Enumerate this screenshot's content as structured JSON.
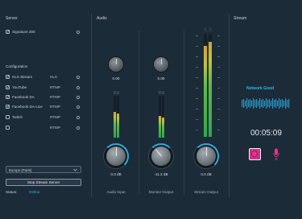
{
  "sections": {
    "server": "Server",
    "audio": "Audio",
    "stream": "Stream"
  },
  "server": {
    "name": "Signature 200",
    "checked": true
  },
  "configuration": {
    "title": "Configuration",
    "destinations": [
      {
        "name": "HLS Stream",
        "protocol": "HLS",
        "checked": true
      },
      {
        "name": "YouTube",
        "protocol": "RTMP",
        "checked": true
      },
      {
        "name": "Facebook DA",
        "protocol": "RTMP",
        "checked": true
      },
      {
        "name": "Facebook DA-Live",
        "protocol": "RTMP",
        "checked": true
      },
      {
        "name": "Twitch",
        "protocol": "RTMP",
        "checked": false
      },
      {
        "name": "",
        "protocol": "RTMP",
        "checked": false
      }
    ]
  },
  "region_select": {
    "value": "Europe (Paris)"
  },
  "stop_button": "Stop Stream Server",
  "status": {
    "label": "Status:",
    "value": "Online"
  },
  "channels": [
    {
      "name": "Audio Input",
      "trim": "0.00",
      "gain": "0.0 dB",
      "level": 0.62
    },
    {
      "name": "Monitor Output",
      "trim": "0.00",
      "gain": "-11.2 dB",
      "level": 0.52
    },
    {
      "name": "Stream Output",
      "trim": "",
      "gain": "0.0 dB",
      "level": 0.9
    }
  ],
  "stream": {
    "network_status": "Network Good",
    "timer": "00:05:09"
  },
  "colors": {
    "accent": "#31a9d8",
    "network": "#2fb8e8",
    "record": "#cf2f88",
    "online": "#2fb8e8"
  }
}
